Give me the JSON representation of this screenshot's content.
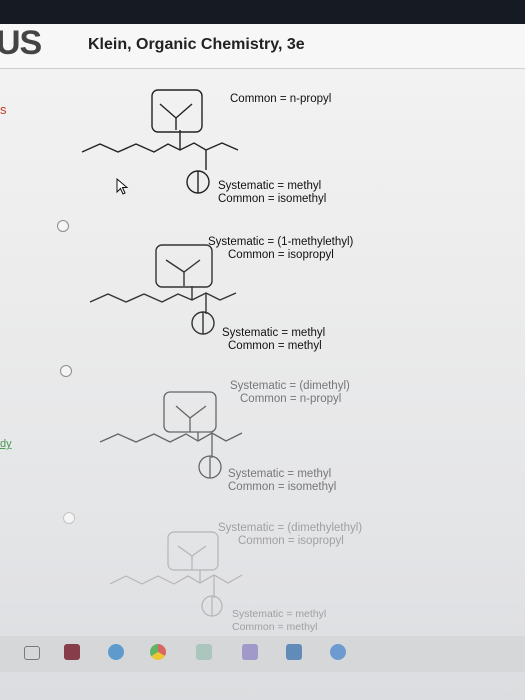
{
  "header": {
    "logo_text": "US",
    "book_title": "Klein, Organic Chemistry, 3e"
  },
  "sidebar": {
    "tab_s": "s",
    "tab_dy": "dy"
  },
  "answer_options": [
    {
      "top_label": "Common = n-propyl",
      "bottom_systematic": "Systematic = methyl",
      "bottom_common": "Common = isomethyl"
    },
    {
      "top_systematic": "Systematic = (1-methylethyl)",
      "top_common": "Common = isopropyl",
      "bottom_systematic": "Systematic = methyl",
      "bottom_common": "Common = methyl"
    },
    {
      "top_systematic": "Systematic = (dimethyl)",
      "top_common": "Common = n-propyl",
      "bottom_systematic": "Systematic = methyl",
      "bottom_common": "Common = isomethyl"
    },
    {
      "top_systematic": "Systematic = (dimethylethyl)",
      "top_common": "Common = isopropyl",
      "bottom_systematic": "Systematic = methyl",
      "bottom_common": "Common = methyl"
    }
  ],
  "taskbar": {
    "icons": [
      "task-view-icon",
      "app-red-icon",
      "edge-icon",
      "chrome-icon",
      "file-explorer-icon",
      "store-icon",
      "mail-icon",
      "photos-icon"
    ]
  },
  "colors": {
    "topbar": "#161a22",
    "accent_red": "#c13a2a",
    "link_green": "#4a9a55"
  }
}
